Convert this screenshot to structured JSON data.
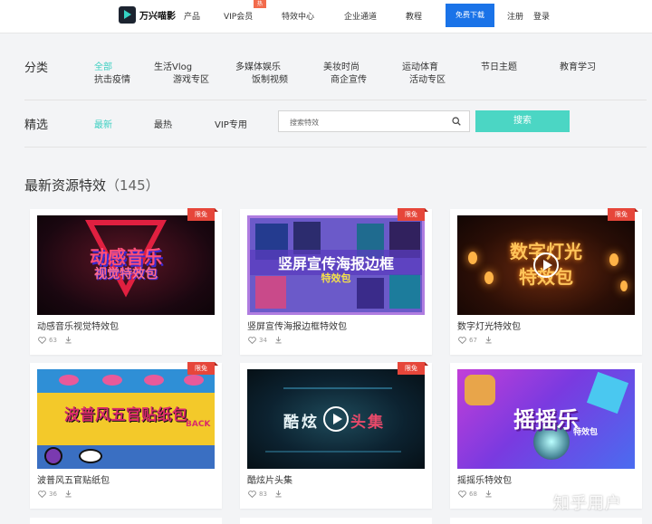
{
  "header": {
    "logo_text": "万兴喵影",
    "nav": [
      "产品",
      "VIP会员",
      "特效中心",
      "企业通道",
      "教程"
    ],
    "hot_badge": "热",
    "download_label": "免费下载",
    "register_label": "注册",
    "login_label": "登录"
  },
  "filters": {
    "category_label": "分类",
    "categories_row1": [
      "全部",
      "生活Vlog",
      "多媒体娱乐",
      "美妆时尚",
      "运动体育",
      "节日主题",
      "教育学习"
    ],
    "categories_row2": [
      "抗击疫情",
      "游戏专区",
      "饭制视频",
      "商企宣传",
      "活动专区"
    ],
    "sort_label": "精选",
    "sorts": [
      "最新",
      "最热",
      "VIP专用"
    ],
    "search_placeholder": "搜索特效",
    "search_button": "搜索"
  },
  "section": {
    "title": "最新资源特效",
    "count": "（145）"
  },
  "cards": [
    {
      "title": "动感音乐视觉特效包",
      "likes": "63",
      "badge": "限免",
      "overlay": [
        "动感音乐",
        "视觉特效包"
      ]
    },
    {
      "title": "竖屏宣传海报边框特效包",
      "likes": "34",
      "badge": "限免",
      "overlay": [
        "竖屏宣传海报边框",
        "特效包"
      ]
    },
    {
      "title": "数字灯光特效包",
      "likes": "67",
      "badge": "限免",
      "overlay": [
        "数字灯光",
        "特效包"
      ]
    },
    {
      "title": "波普风五官贴纸包",
      "likes": "36",
      "badge": "限免",
      "overlay": [
        "波普风五官贴纸包",
        "BACK"
      ]
    },
    {
      "title": "酷炫片头集",
      "likes": "83",
      "badge": "限免",
      "overlay": [
        "酷炫",
        "头集"
      ]
    },
    {
      "title": "摇摇乐特效包",
      "likes": "68",
      "badge": "",
      "overlay": [
        "摇摇乐",
        "特效包"
      ]
    }
  ],
  "watermark": "知乎用户",
  "colors": {
    "accent": "#3ccfc1",
    "primary": "#1a73e8",
    "badge": "#e6463a"
  }
}
